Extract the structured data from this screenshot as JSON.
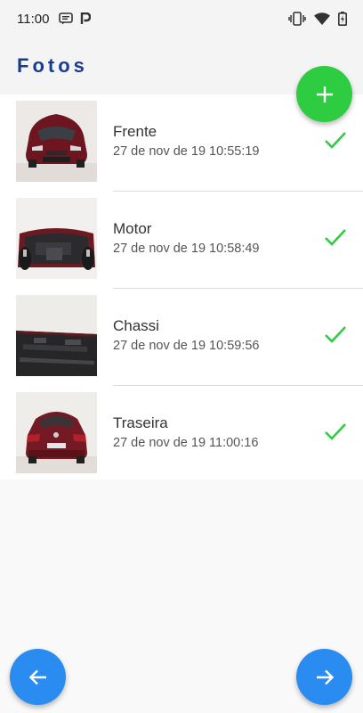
{
  "status": {
    "time": "11:00",
    "left_icons": [
      "message-icon",
      "parking-icon"
    ],
    "right_icons": [
      "vibrate-icon",
      "wifi-icon",
      "battery-charging-icon"
    ]
  },
  "appbar": {
    "title": "Fotos"
  },
  "colors": {
    "title": "#1a3c8c",
    "add_fab": "#2ecc40",
    "nav_fab": "#2a8cf0",
    "check": "#2ecc40",
    "car": "#7a1a22"
  },
  "photos": [
    {
      "label": "Frente",
      "date": "27 de nov de 19 10:55:19",
      "image": "car-front-photo",
      "status_icon": "check-icon"
    },
    {
      "label": "Motor",
      "date": "27 de nov de 19 10:58:49",
      "image": "car-engine-underside-photo",
      "status_icon": "check-icon"
    },
    {
      "label": "Chassi",
      "date": "27 de nov de 19 10:59:56",
      "image": "car-chassis-photo",
      "status_icon": "check-icon"
    },
    {
      "label": "Traseira",
      "date": "27 de nov de 19 11:00:16",
      "image": "car-rear-photo",
      "status_icon": "check-icon"
    }
  ],
  "buttons": {
    "add": {
      "icon": "plus-icon"
    },
    "back": {
      "icon": "arrow-left-icon"
    },
    "next": {
      "icon": "arrow-right-icon"
    }
  }
}
